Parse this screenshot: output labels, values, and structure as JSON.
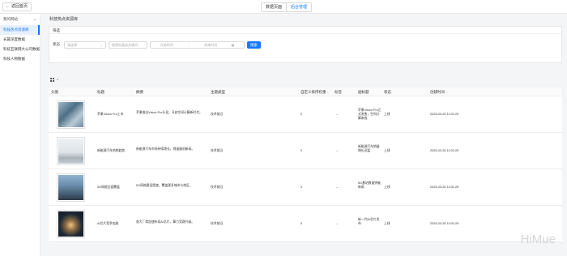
{
  "topbar": {
    "back_label": "返回首页",
    "tabs": [
      "数据页面",
      "后台管理"
    ]
  },
  "sidebar": {
    "group_label": "我的网站",
    "items": [
      "科技热点资源库",
      "长篇深度数据",
      "科技互联网大公司数据",
      "科技人物数据"
    ]
  },
  "page": {
    "title": "科技热点资源库"
  },
  "filter": {
    "section_label": "筛选",
    "status_label": "状态",
    "status_placeholder": "请选择",
    "keyword_placeholder": "搜索标题或关键词",
    "date_start_placeholder": "开始时间",
    "date_separator": "→",
    "date_end_placeholder": "结束时间",
    "search_button": "搜索"
  },
  "table": {
    "columns": [
      "头图",
      "标题",
      "摘要",
      "主题类型",
      "自定义排序权重",
      "标签",
      "副标题",
      "状态",
      "创建时间"
    ],
    "rows": [
      {
        "title": "苹果Vision Pro上市",
        "summary": "苹果推出Vision Pro头显，开启空间计算新时代。",
        "type": "技术前沿",
        "weight": "0",
        "tag": "--",
        "subtitle": "苹果Vision Pro正式发售，空间计算来临",
        "status": "上线",
        "created": "2025-03-25 10:31:25"
      },
      {
        "title": "新能源汽车热销趋势",
        "summary": "新能源汽车市场持续增长，销量屡创新高。",
        "type": "技术前沿",
        "weight": "0",
        "tag": "--",
        "subtitle": "新能源汽车销量增长迅猛",
        "status": "上线",
        "created": "2025-03-25 10:31:25"
      },
      {
        "title": "5G网络全面覆盖",
        "summary": "5G网络建设提速，覆盖更多城市与地区。",
        "type": "技术前沿",
        "weight": "0",
        "tag": "--",
        "subtitle": "5G基站数量突破新高",
        "status": "上线",
        "created": "2025-03-25 10:31:25"
      },
      {
        "title": "AI芯片竞争加剧",
        "summary": "各大厂商加速布局AI芯片，算力竞赛升级。",
        "type": "技术前沿",
        "weight": "0",
        "tag": "--",
        "subtitle": "新一代AI芯片发布",
        "status": "上线",
        "created": "2025-03-25 10:31:25"
      }
    ]
  },
  "watermark": "HiMue"
}
